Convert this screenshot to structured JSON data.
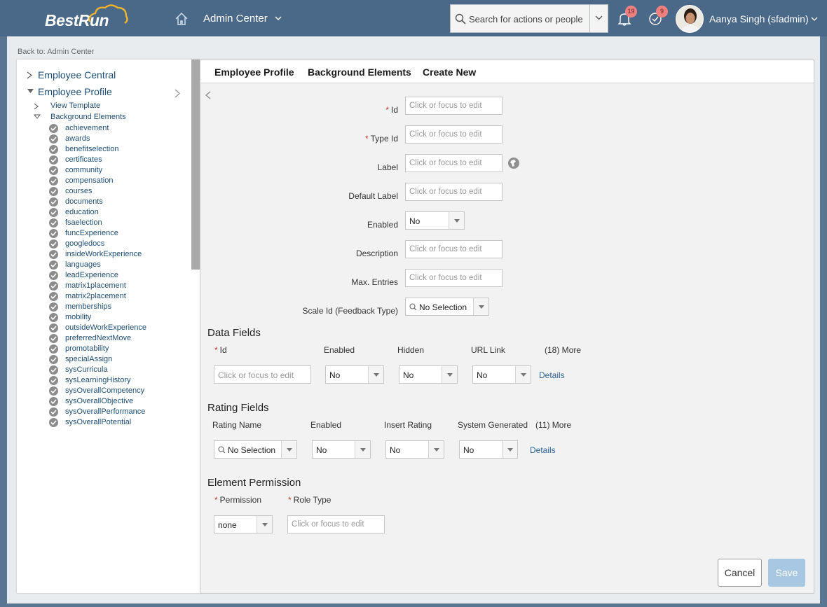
{
  "header": {
    "logo_text": "BestRun",
    "admin_center": "Admin Center",
    "search_placeholder": "Search for actions or people",
    "notifications_count": "19",
    "tasks_count": "9",
    "user_name": "Aanya Singh (sfadmin)"
  },
  "back_link": "Back to: Admin Center",
  "sidebar": {
    "employee_central": "Employee Central",
    "employee_profile": "Employee Profile",
    "view_template": "View Template",
    "background_elements": "Background Elements",
    "elements": [
      "achievement",
      "awards",
      "benefitselection",
      "certificates",
      "community",
      "compensation",
      "courses",
      "documents",
      "education",
      "fsaelection",
      "funcExperience",
      "googledocs",
      "insideWorkExperience",
      "languages",
      "leadExperience",
      "matrix1placement",
      "matrix2placement",
      "memberships",
      "mobility",
      "outsideWorkExperience",
      "preferredNextMove",
      "promotability",
      "specialAssign",
      "sysCurricula",
      "sysLearningHistory",
      "sysOverallCompetency",
      "sysOverallObjective",
      "sysOverallPerformance",
      "sysOverallPotential"
    ]
  },
  "tabs": {
    "employee_profile": "Employee Profile",
    "background_elements": "Background Elements",
    "create_new": "Create New"
  },
  "form": {
    "required_mark": "*",
    "placeholder": "Click or focus to edit",
    "id_label": "Id",
    "type_id_label": "Type Id",
    "label_label": "Label",
    "default_label_label": "Default Label",
    "enabled_label": "Enabled",
    "enabled_value": "No",
    "description_label": "Description",
    "max_entries_label": "Max. Entries",
    "scale_id_label": "Scale Id (Feedback Type)",
    "scale_id_value": "No Selection"
  },
  "data_fields": {
    "title": "Data Fields",
    "col_id": "Id",
    "col_enabled": "Enabled",
    "col_hidden": "Hidden",
    "col_url_link": "URL Link",
    "col_more": "(18) More",
    "enabled_value": "No",
    "hidden_value": "No",
    "url_link_value": "No",
    "details": "Details"
  },
  "rating_fields": {
    "title": "Rating Fields",
    "col_rating_name": "Rating Name",
    "col_enabled": "Enabled",
    "col_insert_rating": "Insert Rating",
    "col_system_generated": "System Generated",
    "col_more": "(11) More",
    "rating_name_value": "No Selection",
    "enabled_value": "No",
    "insert_rating_value": "No",
    "system_generated_value": "No",
    "details": "Details"
  },
  "element_permission": {
    "title": "Element Permission",
    "col_permission": "Permission",
    "col_role_type": "Role Type",
    "permission_value": "none"
  },
  "buttons": {
    "cancel": "Cancel",
    "save": "Save"
  },
  "colors": {
    "header_bg": "#4a6888",
    "link": "#1d4e74",
    "required": "#c0392b",
    "badge": "#f08080",
    "save_disabled": "#a7c7e2"
  }
}
